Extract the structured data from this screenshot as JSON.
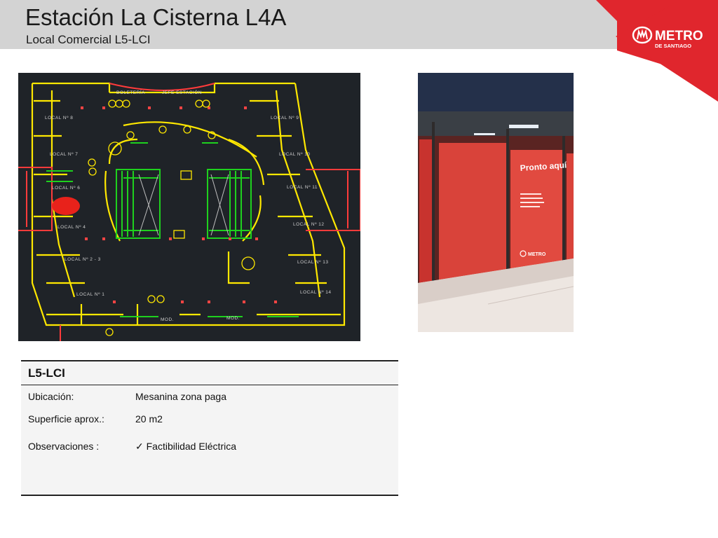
{
  "header": {
    "title": "Estación La Cisterna L4A",
    "subtitle": "Local Comercial L5-LCI"
  },
  "logo": {
    "name": "METRO",
    "tagline": "DE SANTIAGO",
    "color": "#e0262d"
  },
  "floor_plan": {
    "background": "#1f2328",
    "labels": {
      "boleteria": "BOLETERÍA",
      "jefe_estacion": "JEFE ESTACIÓN",
      "local_8": "LOCAL Nº 8",
      "local_7": "LOCAL Nº 7",
      "local_6": "LOCAL Nº 6",
      "local_4": "LOCAL Nº 4",
      "local_23": "LOCAL Nº 2 - 3",
      "local_1": "LOCAL Nº 1",
      "local_9": "LOCAL Nº 9",
      "local_10": "LOCAL Nº 10",
      "local_11": "LOCAL Nº 11",
      "local_12": "LOCAL Nº 12",
      "local_13": "LOCAL Nº 13",
      "local_14": "LOCAL Nº 14",
      "mod1": "MOD.",
      "mod2": "MOD."
    },
    "marker_color": "#e8221b"
  },
  "photo": {
    "ad_title": "Pronto aquí",
    "ad_text": "comida, servicios, entretención y mucho más.",
    "ad_logo": "METRO"
  },
  "info": {
    "title": "L5-LCI",
    "rows": [
      {
        "label": "Ubicación:",
        "value": "Mesanina zona paga"
      },
      {
        "label": "Superficie aprox.:",
        "value": "20 m2"
      },
      {
        "label": "Observaciones :",
        "value": "✓ Factibilidad Eléctrica"
      }
    ]
  }
}
